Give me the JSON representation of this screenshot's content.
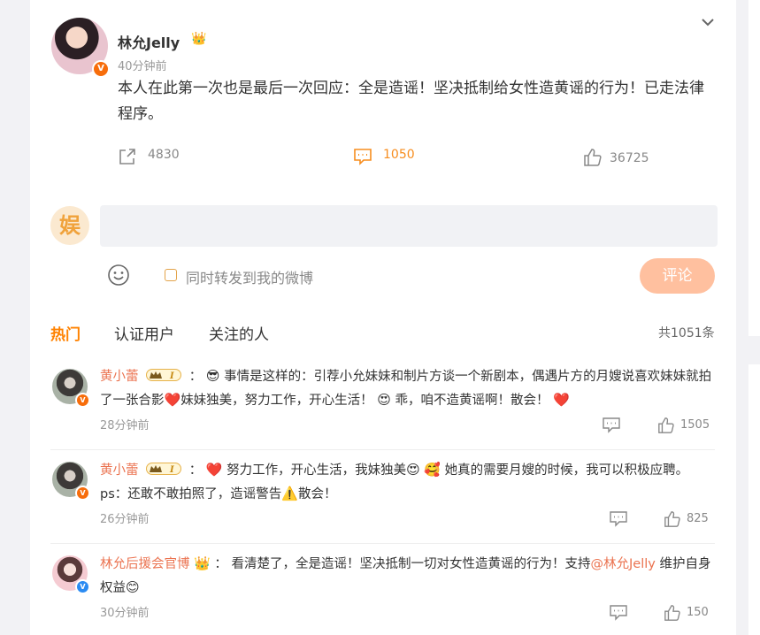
{
  "post": {
    "author": "林允Jelly",
    "time": "40分钟前",
    "text": "本人在此第一次也是最后一次回应：全是造谣！坚决抵制给女性造黄谣的行为！已走法律程序。",
    "repost_count": "4830",
    "comment_count": "1050",
    "like_count": "36725"
  },
  "composer": {
    "avatar_text": "娱",
    "input_placeholder": "",
    "repost_checkbox_label": "同时转发到我的微博",
    "submit_label": "评论"
  },
  "tabs": {
    "hot": "热门",
    "verified": "认证用户",
    "following": "关注的人",
    "total": "共1051条"
  },
  "comments": [
    {
      "name": "黄小蕾",
      "colon": "：",
      "text_a": "事情是这样的：引荐小允妹妹和制片方谈一个新剧本，偶遇片方的月嫂说喜欢妹妹就拍了一张合影",
      "text_b": "妹妹独美，努力工作，开心生活！",
      "text_c": "乖，咱不造黄谣啊！散会！",
      "time": "28分钟前",
      "likes": "1505"
    },
    {
      "name": "黄小蕾",
      "colon": "：",
      "text_a": "努力工作，开心生活，我妹独美",
      "text_b": "她真的需要月嫂的时候，我可以积极应聘。ps：还敢不敢拍照了，造谣警告",
      "text_c": "散会！",
      "time": "26分钟前",
      "likes": "825"
    },
    {
      "name": "林允后援会官博",
      "colon": "：",
      "text_a": "看清楚了，全是造谣！坚决抵制一切对女性造黄谣的行为！支持",
      "mention": "@林允Jelly",
      "text_b": "维护自身权益",
      "time": "30分钟前",
      "likes": "150"
    }
  ],
  "colors": {
    "accent": "#ff8200",
    "name_link": "#eb7350",
    "submit_bg": "#ffc09f",
    "verified_orange": "#f76d0b",
    "verified_blue": "#2b8bf2"
  }
}
